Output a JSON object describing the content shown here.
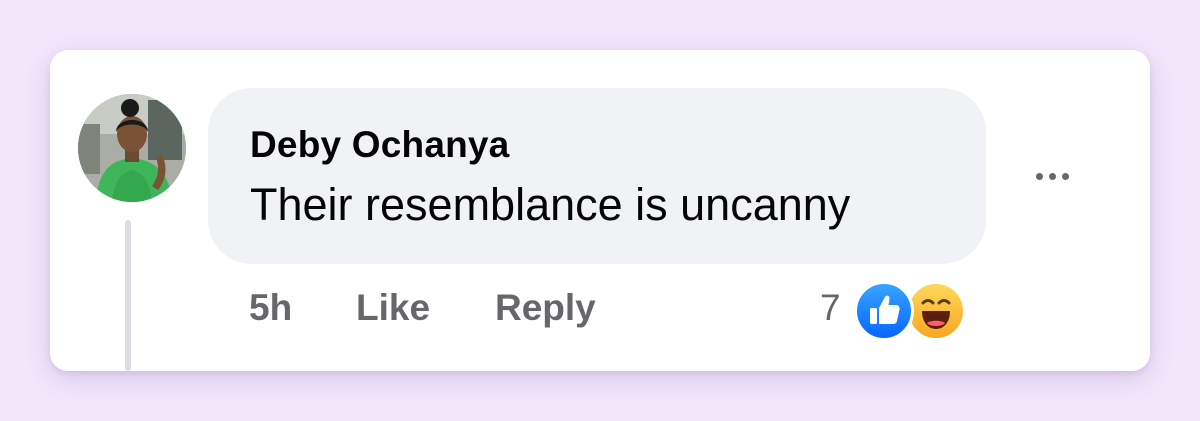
{
  "comment": {
    "author": "Deby Ochanya",
    "text": "Their resemblance is uncanny",
    "timestamp": "5h",
    "like_label": "Like",
    "reply_label": "Reply",
    "reaction_count": "7",
    "reactions": [
      "like",
      "haha"
    ],
    "more_icon": "more-horizontal-icon",
    "avatar_icon": "profile-photo"
  },
  "colors": {
    "background": "#f2e6fb",
    "card": "#ffffff",
    "bubble": "#f0f2f5",
    "primary_text": "#050505",
    "secondary_text": "#65676b",
    "like_blue": "#0866ff",
    "haha_yellow": "#ffd85a"
  }
}
